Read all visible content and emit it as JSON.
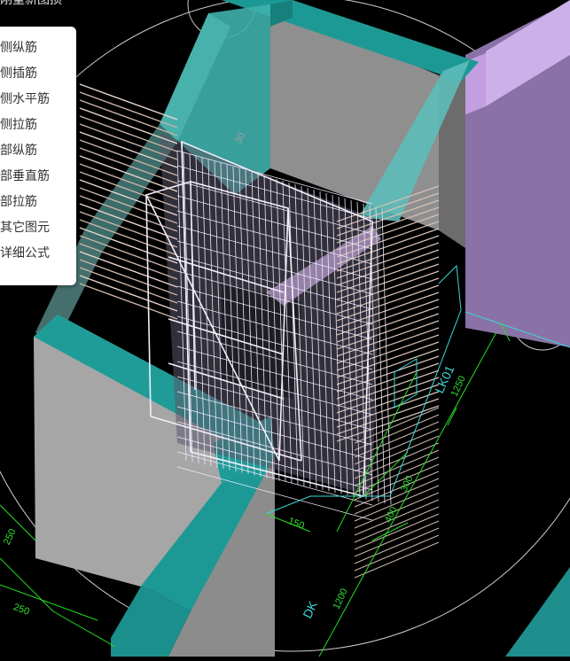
{
  "panel": {
    "title": "刚重新图损",
    "items": [
      {
        "label": "侧纵筋"
      },
      {
        "label": "侧插筋"
      },
      {
        "label": "侧水平筋"
      },
      {
        "label": "侧拉筋"
      },
      {
        "label": "部纵筋"
      },
      {
        "label": "部垂直筋"
      },
      {
        "label": "部拉筋"
      },
      {
        "label": "其它图元"
      },
      {
        "label": "详细公式"
      }
    ]
  },
  "annotations": {
    "label_lk": "LK01",
    "label_dk": "DK",
    "dim_1250": "1250",
    "dim_1200": "1200",
    "dim_300": "300",
    "dim_400": "400",
    "dim_250_a": "250",
    "dim_250_b": "250",
    "dim_150": "150",
    "dim_30": "30"
  },
  "colors": {
    "background": "#000000",
    "wall_teal": "#1f9c98",
    "wall_face_grey": "#a9a9a9",
    "purple_block": "#9a7ab6",
    "dimension_green": "#22dd22",
    "label_cyan": "#39d8d8",
    "rebar_white": "#f0eef6"
  }
}
